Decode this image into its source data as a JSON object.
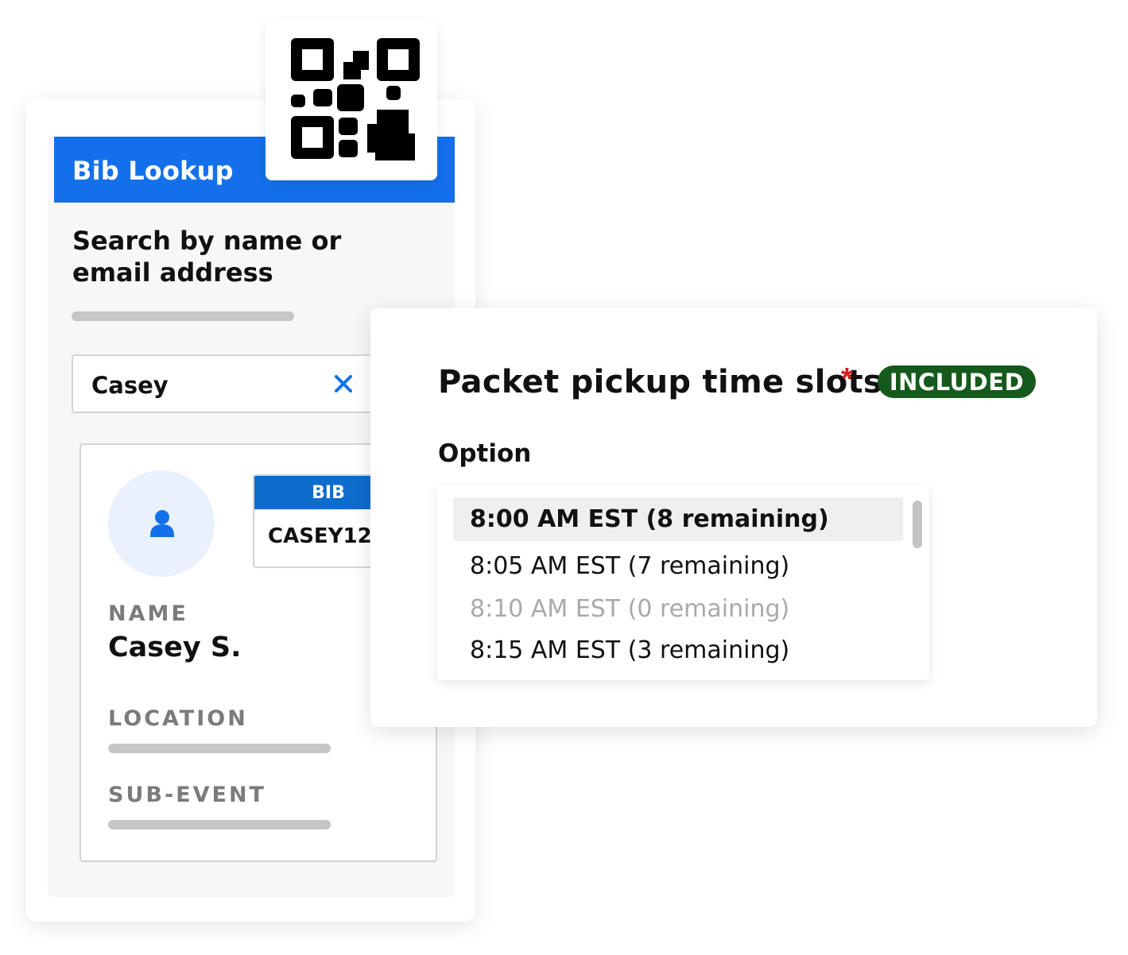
{
  "bib_lookup": {
    "title": "Bib Lookup",
    "search_heading": "Search by name or email address",
    "search_value": "Casey",
    "result": {
      "bib_label": "BIB",
      "bib_number": "CASEY12",
      "name_label": "NAME",
      "name_value": "Casey S.",
      "location_label": "LOCATION",
      "sub_event_label": "SUB-EVENT"
    }
  },
  "time_slots": {
    "title": "Packet pickup time slots",
    "required_marker": "*",
    "badge": "INCLUDED",
    "option_label": "Option",
    "options": [
      {
        "label": "8:00 AM EST (8 remaining)",
        "state": "selected"
      },
      {
        "label": "8:05 AM EST (7 remaining)",
        "state": "available"
      },
      {
        "label": "8:10 AM EST (0 remaining)",
        "state": "disabled"
      },
      {
        "label": "8:15 AM EST (3 remaining)",
        "state": "available"
      }
    ]
  },
  "colors": {
    "brand_blue": "#1470ea",
    "bib_blue": "#0e6ccc",
    "included_green": "#155a1c",
    "required_red": "#d42020"
  },
  "icons": [
    "qr-code-icon",
    "close-icon",
    "user-icon"
  ]
}
